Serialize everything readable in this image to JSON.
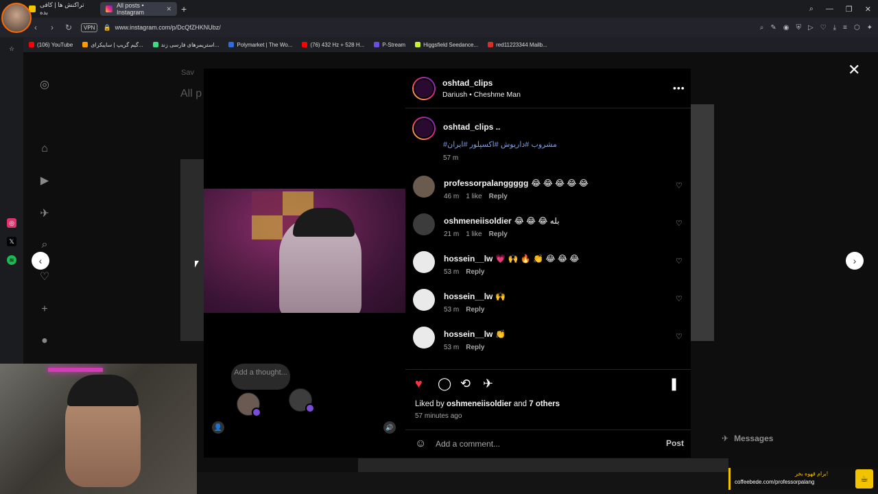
{
  "browser": {
    "tabs": [
      {
        "label": "تراکنش ها | کافی بده",
        "active": false
      },
      {
        "label": "All posts • Instagram",
        "active": true
      }
    ],
    "new_tab": "+",
    "url": "www.instagram.com/p/DcQfZHKNUbz/",
    "vpn": "VPN",
    "bookmarks": [
      {
        "label": "(106) YouTube",
        "color": "#ff0000"
      },
      {
        "label": "گیم گریپ | سایبکرای...",
        "color": "#ff9c00"
      },
      {
        "label": "استریمرهای فارسی زند...",
        "color": "#3ddc84"
      },
      {
        "label": "Polymarket | The Wo...",
        "color": "#2d6cdf"
      },
      {
        "label": "(76) 432 Hz + 528 H...",
        "color": "#ff0000"
      },
      {
        "label": "P-Stream",
        "color": "#6b4de6"
      },
      {
        "label": "Higgsfield Seedance...",
        "color": "#c6f432"
      },
      {
        "label": "red11223344 Mailb...",
        "color": "#d93025"
      }
    ]
  },
  "background": {
    "saved": "Sav",
    "title": "All p"
  },
  "post": {
    "username": "oshtad_clips",
    "audio": "Dariush • Cheshme Man",
    "caption_user": "oshtad_clips ..",
    "hashtags": "#مشروب #داریوش #اکسپلور #ایران",
    "caption_time": "57 m",
    "comments": [
      {
        "user": "professorpalanggggg",
        "text": "😂 😂 😂 😂 😂",
        "time": "46 m",
        "likes": "1 like",
        "reply": "Reply"
      },
      {
        "user": "oshmeneiisoldier",
        "text": "😂 😂 😂 بله",
        "time": "21 m",
        "likes": "1 like",
        "reply": "Reply"
      },
      {
        "user": "hossein__lw",
        "text": "💗 🙌 🔥 👏 😂 😂 😂",
        "time": "53 m",
        "likes": "",
        "reply": "Reply"
      },
      {
        "user": "hossein__lw",
        "text": "🙌",
        "time": "53 m",
        "likes": "",
        "reply": "Reply"
      },
      {
        "user": "hossein__lw",
        "text": "👏",
        "time": "53 m",
        "likes": "",
        "reply": "Reply"
      }
    ],
    "liked_by_prefix": "Liked by",
    "liked_by_user": "oshmeneiisoldier",
    "liked_by_and": "and",
    "liked_by_others": "7 others",
    "posted_time": "57 minutes ago",
    "comment_placeholder": "Add a comment...",
    "post_button": "Post",
    "thought_placeholder": "Add a thought..."
  },
  "messages_label": "Messages",
  "promo": {
    "headline": "برام قهوه بخر!",
    "url": "coffeebede.com/professorpalang"
  },
  "colors": {
    "like_red": "#ff3040",
    "link_blue": "#7a9ff2",
    "promo_yellow": "#f2c400"
  },
  "icons": {
    "close": "close-icon",
    "prev": "chevron-left-icon",
    "next": "chevron-right-icon"
  }
}
